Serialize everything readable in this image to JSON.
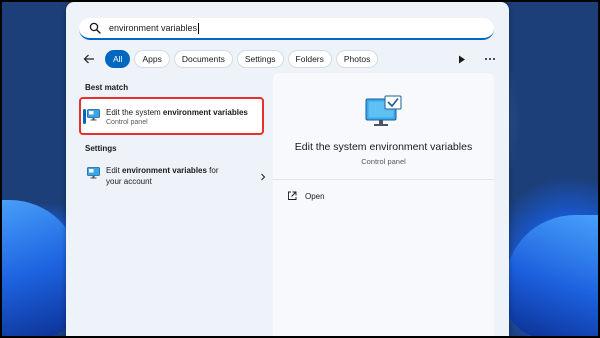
{
  "search": {
    "value": "environment variables"
  },
  "filters": [
    "All",
    "Apps",
    "Documents",
    "Settings",
    "Folders",
    "Photos"
  ],
  "sections": {
    "best_match": "Best match",
    "settings": "Settings"
  },
  "best_match_item": {
    "title_pre": "Edit the system ",
    "title_bold": "environment variables",
    "subtitle": "Control panel"
  },
  "settings_item": {
    "line1_pre": "Edit ",
    "line1_bold": "environment variables",
    "line1_post": " for",
    "line2": "your account"
  },
  "detail": {
    "title": "Edit the system environment variables",
    "subtitle": "Control panel",
    "open_label": "Open"
  },
  "colors": {
    "accent": "#0067c0",
    "highlight_border": "#e4312b"
  }
}
